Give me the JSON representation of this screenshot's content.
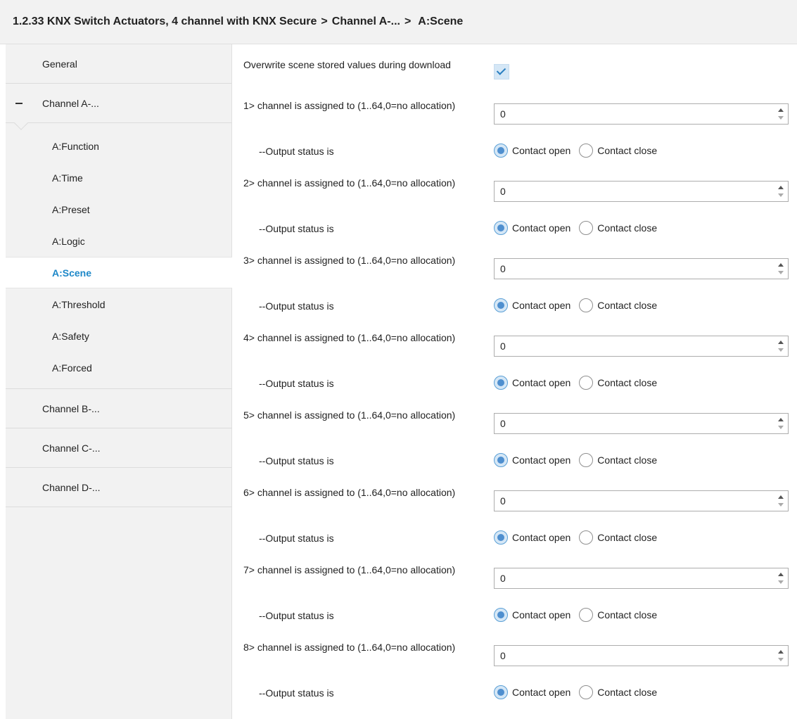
{
  "titlebar": {
    "device": "1.2.33 KNX Switch Actuators, 4 channel with KNX Secure",
    "separator": ">",
    "channel": "Channel A-...",
    "page": "A:Scene"
  },
  "sidebar": {
    "general": "General",
    "channel_a": "Channel A-...",
    "sub_items": [
      "A:Function",
      "A:Time",
      "A:Preset",
      "A:Logic",
      "A:Scene",
      "A:Threshold",
      "A:Safety",
      "A:Forced"
    ],
    "active_sub": "A:Scene",
    "channel_b": "Channel B-...",
    "channel_c": "Channel C-...",
    "channel_d": "Channel D-..."
  },
  "main": {
    "overwrite_label": "Overwrite scene stored values during download",
    "overwrite_checked": true,
    "scenes": [
      {
        "label": "1> channel is assigned to (1..64,0=no allocation)",
        "value": "0",
        "status_label": "--Output status is",
        "selected": "Contact open"
      },
      {
        "label": "2> channel is assigned to (1..64,0=no allocation)",
        "value": "0",
        "status_label": "--Output status is",
        "selected": "Contact open"
      },
      {
        "label": "3> channel is assigned to (1..64,0=no allocation)",
        "value": "0",
        "status_label": "--Output status is",
        "selected": "Contact open"
      },
      {
        "label": "4> channel is assigned to (1..64,0=no allocation)",
        "value": "0",
        "status_label": "--Output status is",
        "selected": "Contact open"
      },
      {
        "label": "5> channel is assigned to (1..64,0=no allocation)",
        "value": "0",
        "status_label": "--Output status is",
        "selected": "Contact open"
      },
      {
        "label": "6> channel is assigned to (1..64,0=no allocation)",
        "value": "0",
        "status_label": "--Output status is",
        "selected": "Contact open"
      },
      {
        "label": "7> channel is assigned to (1..64,0=no allocation)",
        "value": "0",
        "status_label": "--Output status is",
        "selected": "Contact open"
      },
      {
        "label": "8> channel is assigned to (1..64,0=no allocation)",
        "value": "0",
        "status_label": "--Output status is",
        "selected": "Contact open"
      }
    ],
    "radio_options": [
      "Contact open",
      "Contact close"
    ]
  },
  "colors": {
    "accent": "#1e88c8",
    "sidebar_bg": "#f2f2f2",
    "checkbox_bg": "#d5e7f6"
  }
}
